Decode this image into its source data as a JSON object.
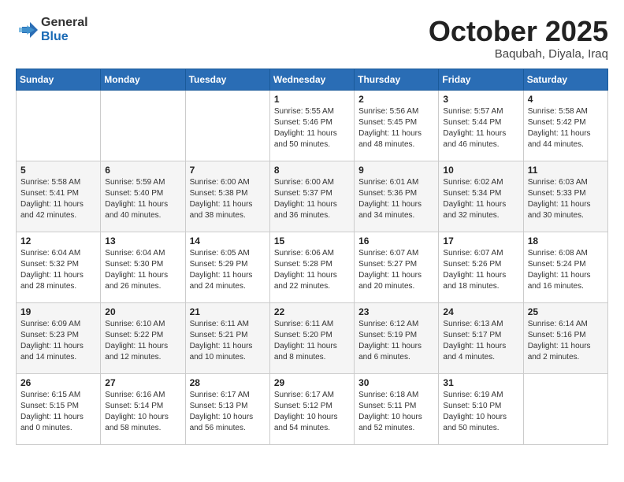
{
  "header": {
    "logo_general": "General",
    "logo_blue": "Blue",
    "month_title": "October 2025",
    "subtitle": "Baqubah, Diyala, Iraq"
  },
  "weekdays": [
    "Sunday",
    "Monday",
    "Tuesday",
    "Wednesday",
    "Thursday",
    "Friday",
    "Saturday"
  ],
  "weeks": [
    [
      {
        "day": "",
        "info": ""
      },
      {
        "day": "",
        "info": ""
      },
      {
        "day": "",
        "info": ""
      },
      {
        "day": "1",
        "info": "Sunrise: 5:55 AM\nSunset: 5:46 PM\nDaylight: 11 hours\nand 50 minutes."
      },
      {
        "day": "2",
        "info": "Sunrise: 5:56 AM\nSunset: 5:45 PM\nDaylight: 11 hours\nand 48 minutes."
      },
      {
        "day": "3",
        "info": "Sunrise: 5:57 AM\nSunset: 5:44 PM\nDaylight: 11 hours\nand 46 minutes."
      },
      {
        "day": "4",
        "info": "Sunrise: 5:58 AM\nSunset: 5:42 PM\nDaylight: 11 hours\nand 44 minutes."
      }
    ],
    [
      {
        "day": "5",
        "info": "Sunrise: 5:58 AM\nSunset: 5:41 PM\nDaylight: 11 hours\nand 42 minutes."
      },
      {
        "day": "6",
        "info": "Sunrise: 5:59 AM\nSunset: 5:40 PM\nDaylight: 11 hours\nand 40 minutes."
      },
      {
        "day": "7",
        "info": "Sunrise: 6:00 AM\nSunset: 5:38 PM\nDaylight: 11 hours\nand 38 minutes."
      },
      {
        "day": "8",
        "info": "Sunrise: 6:00 AM\nSunset: 5:37 PM\nDaylight: 11 hours\nand 36 minutes."
      },
      {
        "day": "9",
        "info": "Sunrise: 6:01 AM\nSunset: 5:36 PM\nDaylight: 11 hours\nand 34 minutes."
      },
      {
        "day": "10",
        "info": "Sunrise: 6:02 AM\nSunset: 5:34 PM\nDaylight: 11 hours\nand 32 minutes."
      },
      {
        "day": "11",
        "info": "Sunrise: 6:03 AM\nSunset: 5:33 PM\nDaylight: 11 hours\nand 30 minutes."
      }
    ],
    [
      {
        "day": "12",
        "info": "Sunrise: 6:04 AM\nSunset: 5:32 PM\nDaylight: 11 hours\nand 28 minutes."
      },
      {
        "day": "13",
        "info": "Sunrise: 6:04 AM\nSunset: 5:30 PM\nDaylight: 11 hours\nand 26 minutes."
      },
      {
        "day": "14",
        "info": "Sunrise: 6:05 AM\nSunset: 5:29 PM\nDaylight: 11 hours\nand 24 minutes."
      },
      {
        "day": "15",
        "info": "Sunrise: 6:06 AM\nSunset: 5:28 PM\nDaylight: 11 hours\nand 22 minutes."
      },
      {
        "day": "16",
        "info": "Sunrise: 6:07 AM\nSunset: 5:27 PM\nDaylight: 11 hours\nand 20 minutes."
      },
      {
        "day": "17",
        "info": "Sunrise: 6:07 AM\nSunset: 5:26 PM\nDaylight: 11 hours\nand 18 minutes."
      },
      {
        "day": "18",
        "info": "Sunrise: 6:08 AM\nSunset: 5:24 PM\nDaylight: 11 hours\nand 16 minutes."
      }
    ],
    [
      {
        "day": "19",
        "info": "Sunrise: 6:09 AM\nSunset: 5:23 PM\nDaylight: 11 hours\nand 14 minutes."
      },
      {
        "day": "20",
        "info": "Sunrise: 6:10 AM\nSunset: 5:22 PM\nDaylight: 11 hours\nand 12 minutes."
      },
      {
        "day": "21",
        "info": "Sunrise: 6:11 AM\nSunset: 5:21 PM\nDaylight: 11 hours\nand 10 minutes."
      },
      {
        "day": "22",
        "info": "Sunrise: 6:11 AM\nSunset: 5:20 PM\nDaylight: 11 hours\nand 8 minutes."
      },
      {
        "day": "23",
        "info": "Sunrise: 6:12 AM\nSunset: 5:19 PM\nDaylight: 11 hours\nand 6 minutes."
      },
      {
        "day": "24",
        "info": "Sunrise: 6:13 AM\nSunset: 5:17 PM\nDaylight: 11 hours\nand 4 minutes."
      },
      {
        "day": "25",
        "info": "Sunrise: 6:14 AM\nSunset: 5:16 PM\nDaylight: 11 hours\nand 2 minutes."
      }
    ],
    [
      {
        "day": "26",
        "info": "Sunrise: 6:15 AM\nSunset: 5:15 PM\nDaylight: 11 hours\nand 0 minutes."
      },
      {
        "day": "27",
        "info": "Sunrise: 6:16 AM\nSunset: 5:14 PM\nDaylight: 10 hours\nand 58 minutes."
      },
      {
        "day": "28",
        "info": "Sunrise: 6:17 AM\nSunset: 5:13 PM\nDaylight: 10 hours\nand 56 minutes."
      },
      {
        "day": "29",
        "info": "Sunrise: 6:17 AM\nSunset: 5:12 PM\nDaylight: 10 hours\nand 54 minutes."
      },
      {
        "day": "30",
        "info": "Sunrise: 6:18 AM\nSunset: 5:11 PM\nDaylight: 10 hours\nand 52 minutes."
      },
      {
        "day": "31",
        "info": "Sunrise: 6:19 AM\nSunset: 5:10 PM\nDaylight: 10 hours\nand 50 minutes."
      },
      {
        "day": "",
        "info": ""
      }
    ]
  ]
}
